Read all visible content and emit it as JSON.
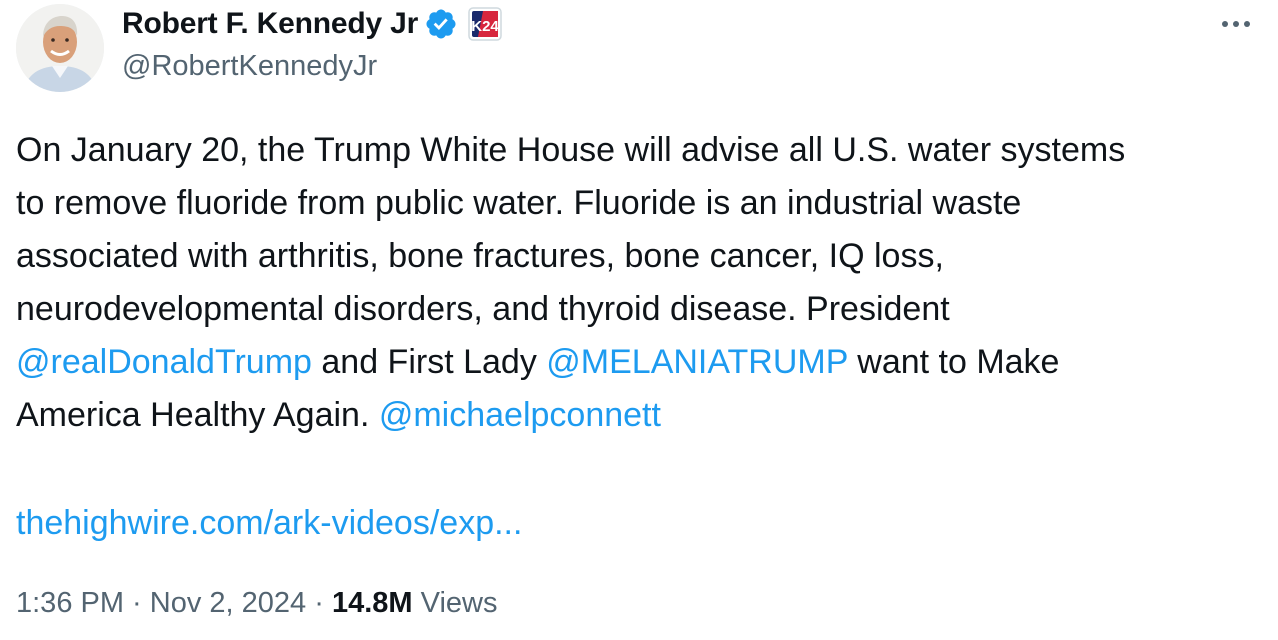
{
  "author": {
    "display_name": "Robert F. Kennedy Jr",
    "handle": "@RobertKennedyJr",
    "verified_icon": "verified-badge-icon",
    "affiliate_badge_text": "K24",
    "avatar": "profile-photo"
  },
  "more_icon": "more-horizontal-icon",
  "tweet": {
    "line1": "On January 20, the Trump White House will advise all U.S. water systems",
    "line2": "to remove fluoride from public water. Fluoride is an industrial waste",
    "line3": "associated with arthritis, bone fractures, bone cancer, IQ loss,",
    "line4": "neurodevelopmental disorders, and thyroid disease. President",
    "mention1": "@realDonaldTrump",
    "line5_mid": " and First Lady ",
    "mention2": "@MELANIATRUMP",
    "line5_end": " want to Make",
    "line6_start": "America Healthy Again. ",
    "mention3": "@michaelpconnett",
    "url": "thehighwire.com/ark-videos/exp..."
  },
  "meta": {
    "time": "1:36 PM",
    "separator": " · ",
    "date": "Nov 2, 2024",
    "views_count": "14.8M",
    "views_label": " Views"
  },
  "colors": {
    "link": "#1d9bf0",
    "text": "#0f1419",
    "secondary": "#536471"
  }
}
